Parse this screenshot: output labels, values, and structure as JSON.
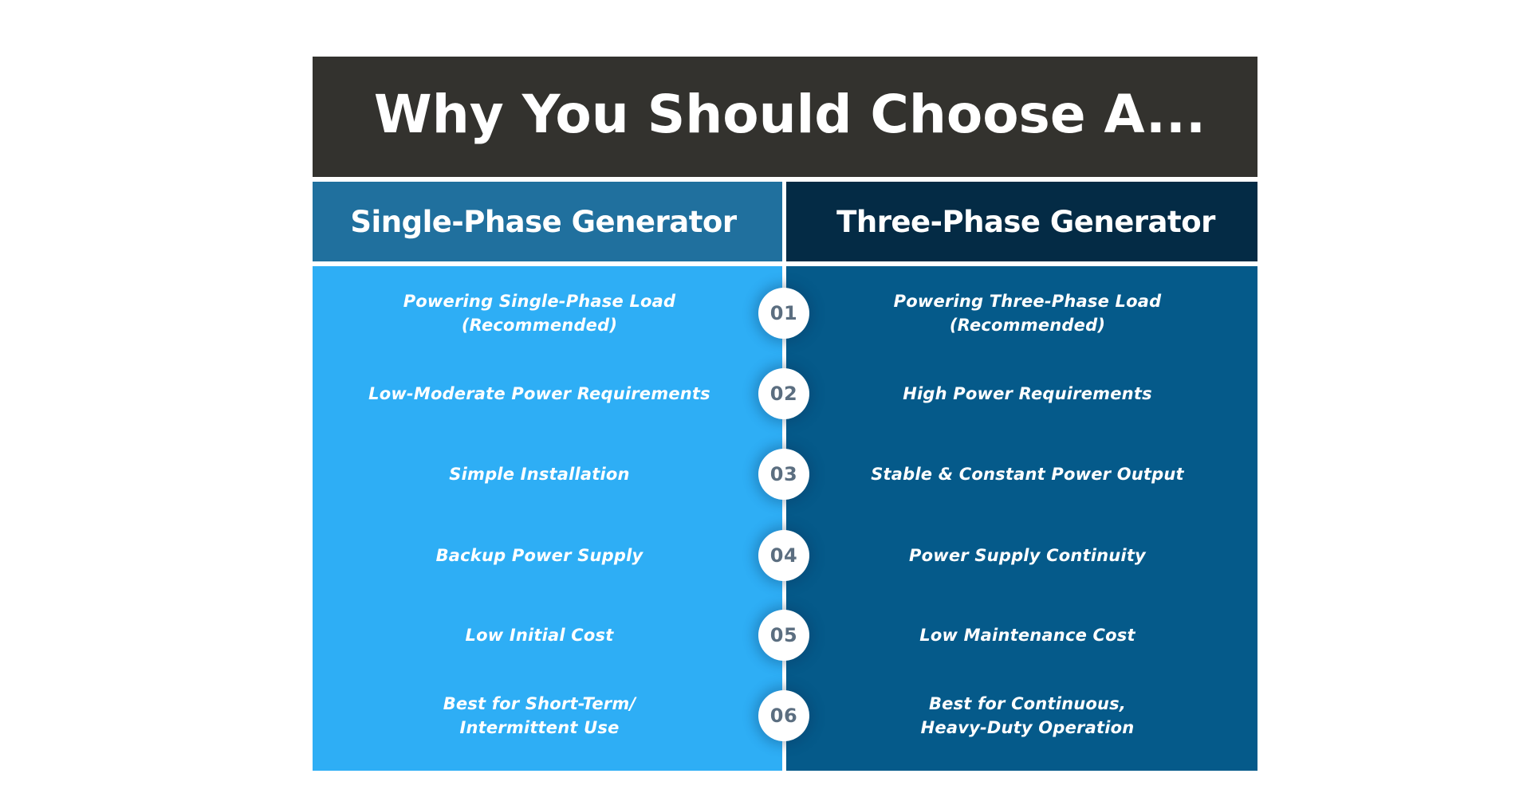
{
  "title": "Why You Should Choose A...",
  "columns": {
    "left": {
      "heading": "Single-Phase Generator"
    },
    "right": {
      "heading": "Three-Phase Generator"
    }
  },
  "rows": [
    {
      "number": "01",
      "left": "Powering Single-Phase Load\n(Recommended)",
      "right": "Powering Three-Phase Load\n(Recommended)"
    },
    {
      "number": "02",
      "left": "Low-Moderate Power Requirements",
      "right": "High Power Requirements"
    },
    {
      "number": "03",
      "left": "Simple Installation",
      "right": "Stable & Constant Power Output"
    },
    {
      "number": "04",
      "left": "Backup Power Supply",
      "right": "Power Supply Continuity"
    },
    {
      "number": "05",
      "left": "Low Initial Cost",
      "right": "Low Maintenance Cost"
    },
    {
      "number": "06",
      "left": "Best for Short-Term/\nIntermittent Use",
      "right": "Best for Continuous,\nHeavy-Duty Operation"
    }
  ],
  "colors": {
    "title_bg": "#33322e",
    "left_header_bg": "#20709e",
    "right_header_bg": "#042b45",
    "left_body_bg": "#2eaef5",
    "right_body_bg": "#055a8a",
    "badge_number": "#5b6e80"
  }
}
